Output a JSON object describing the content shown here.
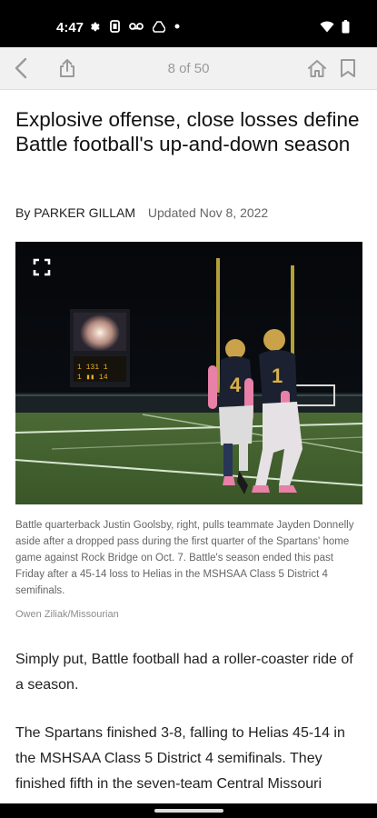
{
  "status_bar": {
    "time": "4:47",
    "left_icons": [
      "gear-icon",
      "data-saver-icon",
      "voicemail-icon",
      "drive-icon",
      "dot-icon"
    ],
    "right_icons": [
      "wifi-icon",
      "battery-icon"
    ]
  },
  "toolbar": {
    "page_counter": "8 of 50",
    "icons": [
      "back-arrow-icon",
      "share-icon",
      "home-icon",
      "bookmark-icon"
    ]
  },
  "article": {
    "headline": "Explosive offense, close losses define Battle football's up-and-down season",
    "byline_prefix": "By",
    "author": "PARKER GILLAM",
    "updated": "Updated Nov 8, 2022",
    "photo": {
      "caption": "Battle quarterback Justin Goolsby, right, pulls teammate Jayden Donnelly aside after a dropped pass during the first quarter of the Spartans' home game against Rock Bridge on Oct. 7. Battle's season ended this past Friday after a 45-14 loss to Helias in the MSHSAA Class 5 District 4 semifinals.",
      "credit": "Owen Ziliak/Missourian",
      "jersey_numbers": [
        "4",
        "1"
      ]
    },
    "paragraphs": [
      "Simply put, Battle football had a roller-coaster ride of a season.",
      "The Spartans finished 3-8, falling to Helias 45-14 in the MSHSAA Class 5 District 4 semifinals. They finished fifth in the seven-team Central Missouri"
    ]
  },
  "colors": {
    "status_bar": "#000000",
    "toolbar": "#f1f1f1",
    "text": "#111111",
    "muted": "#666666"
  }
}
